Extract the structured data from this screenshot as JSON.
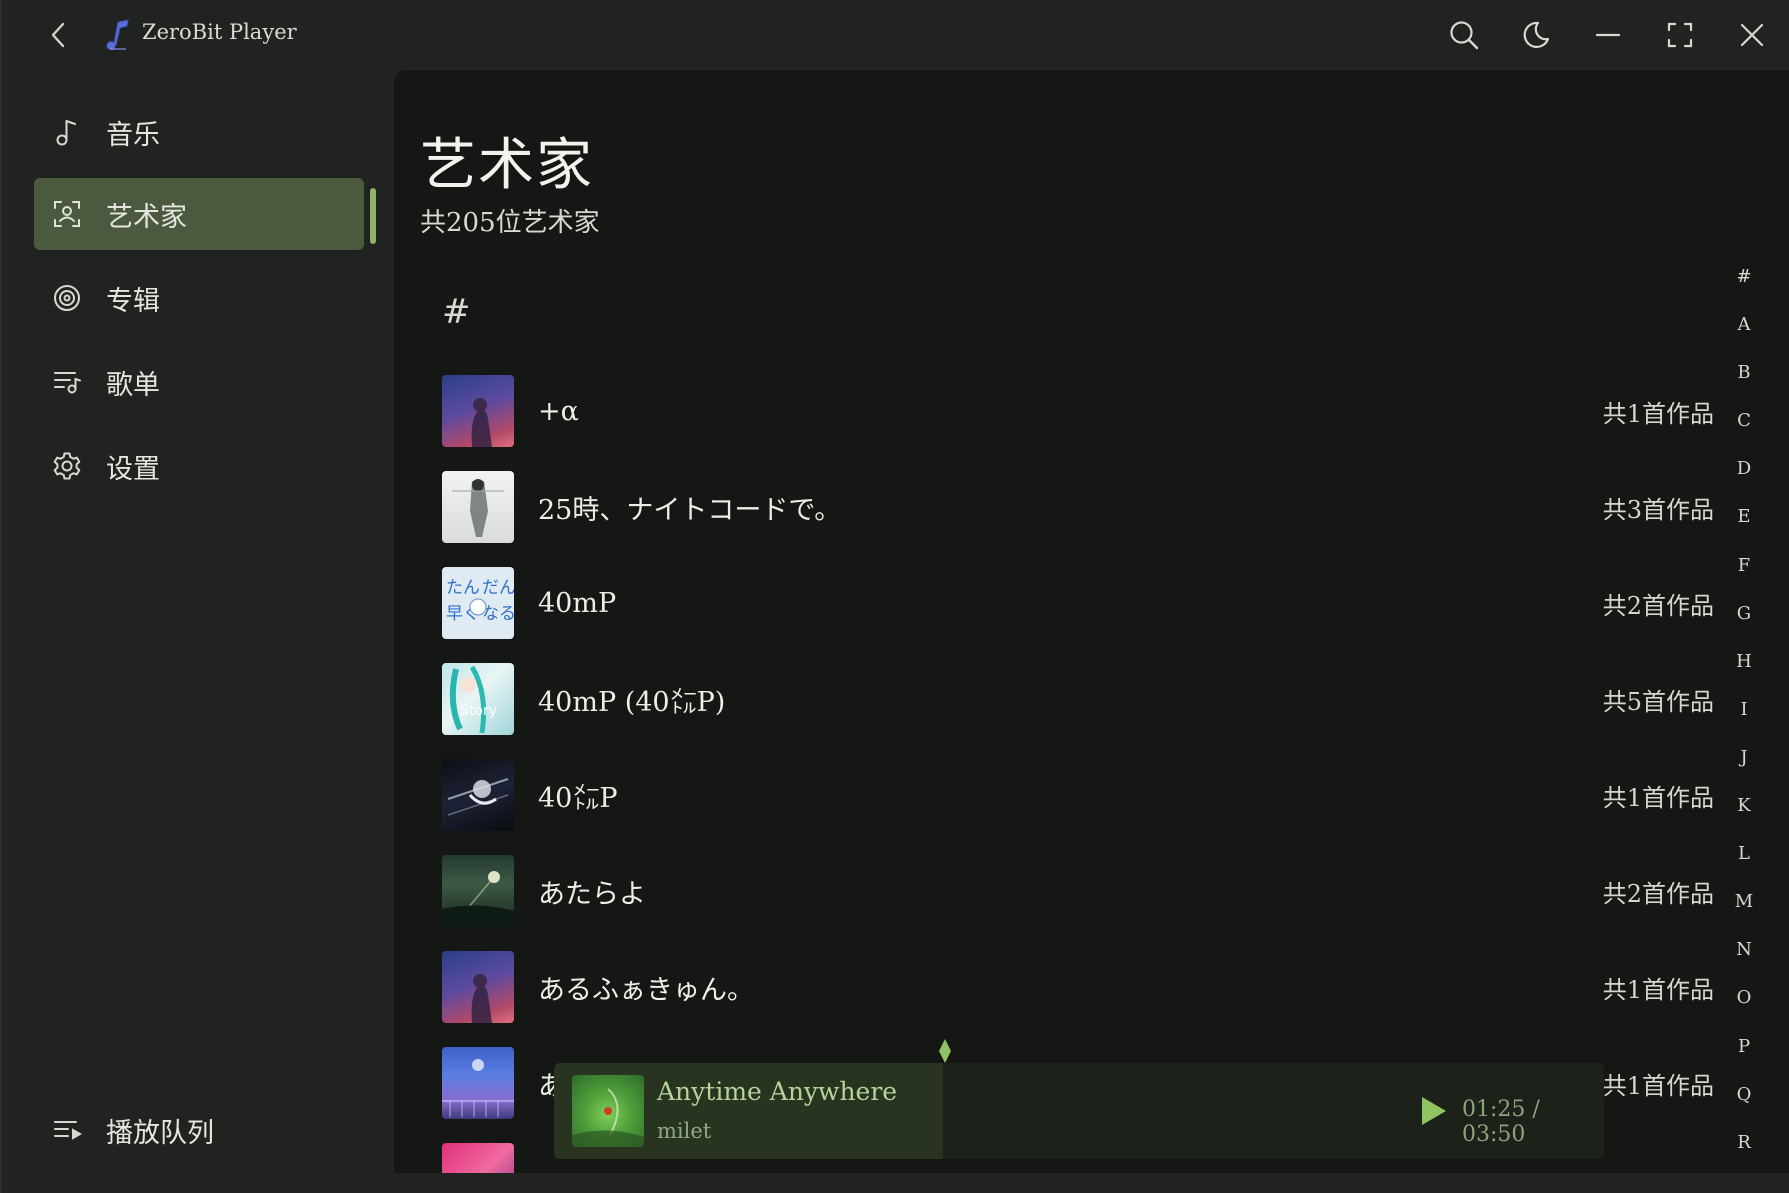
{
  "titlebar": {
    "app_title": "ZeroBit Player",
    "back_icon": "chevron-left-icon",
    "buttons": [
      "search-icon",
      "moon-icon",
      "minimize-icon",
      "maximize-icon",
      "close-icon"
    ]
  },
  "sidebar": {
    "items": [
      {
        "label": "音乐",
        "icon": "music-note-icon"
      },
      {
        "label": "艺术家",
        "icon": "artist-scan-icon",
        "active": true
      },
      {
        "label": "专辑",
        "icon": "disc-icon"
      },
      {
        "label": "歌单",
        "icon": "playlist-icon"
      },
      {
        "label": "设置",
        "icon": "gear-icon"
      }
    ],
    "queue_label": "播放队列",
    "accent": "#8fb46a",
    "active_bg": "#4b5a3e"
  },
  "page": {
    "title": "艺术家",
    "subtitle": "共205位艺术家",
    "group_header": "#"
  },
  "artists": [
    {
      "name": "+α",
      "count": "共1首作品"
    },
    {
      "name": "25時、ナイトコードで。",
      "count": "共3首作品"
    },
    {
      "name": "40mP",
      "count": "共2首作品"
    },
    {
      "name": "40mP (40㍍P)",
      "count": "共5首作品"
    },
    {
      "name": "40㍍P",
      "count": "共1首作品"
    },
    {
      "name": "あたらよ",
      "count": "共2首作品"
    },
    {
      "name": "あるふぁきゅん。",
      "count": "共1首作品"
    },
    {
      "name": "あ",
      "count": "共1首作品"
    }
  ],
  "alphabet": [
    "#",
    "A",
    "B",
    "C",
    "D",
    "E",
    "F",
    "G",
    "H",
    "I",
    "J",
    "K",
    "L",
    "M",
    "N",
    "O",
    "P",
    "Q",
    "R"
  ],
  "player": {
    "song": "Anytime Anywhere",
    "artist": "milet",
    "time": "01:25 / 03:50",
    "progress": 0.37,
    "accent": "#8fc461"
  }
}
